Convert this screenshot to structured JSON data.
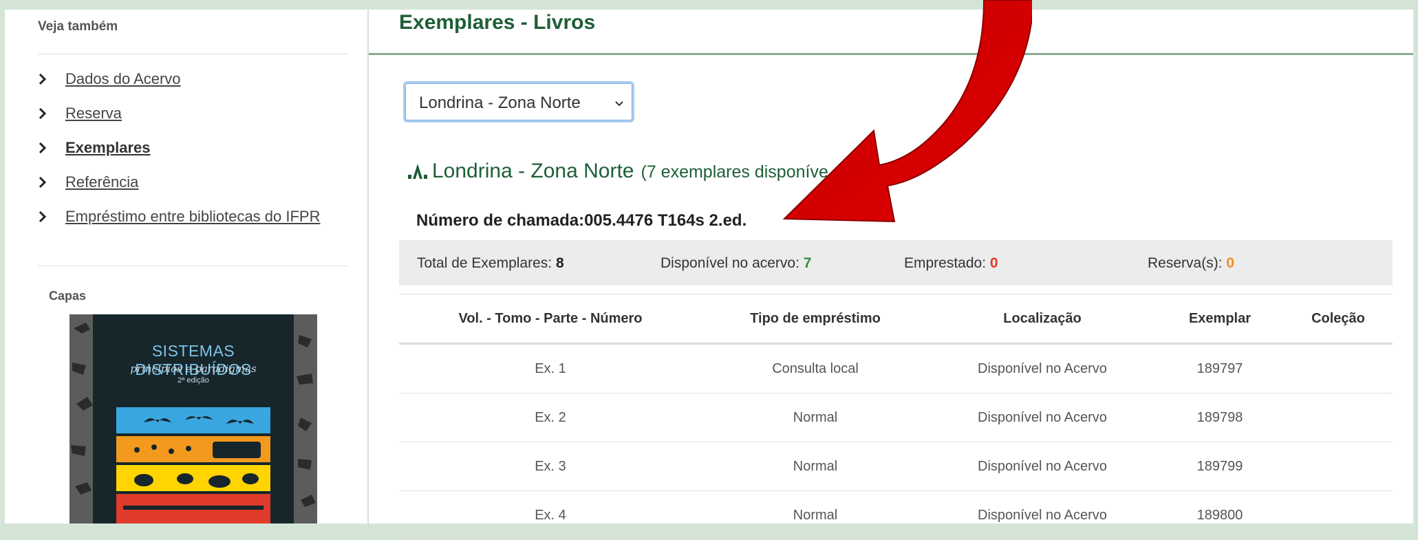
{
  "sidebar": {
    "heading": "Veja também",
    "items": [
      {
        "label": "Dados do Acervo",
        "active": false
      },
      {
        "label": "Reserva",
        "active": false
      },
      {
        "label": "Exemplares",
        "active": true
      },
      {
        "label": "Referência",
        "active": false
      },
      {
        "label": "Empréstimo entre bibliotecas do IFPR",
        "active": false
      }
    ],
    "capas_heading": "Capas",
    "cover": {
      "title": "SISTEMAS DISTRIBUÍDOS",
      "subtitle": "princípios e paradigmas",
      "edition": "2ª edição"
    }
  },
  "main": {
    "title": "Exemplares - Livros",
    "select": {
      "value": "Londrina - Zona Norte"
    },
    "library": {
      "name": "Londrina - Zona Norte",
      "count_text": "(7 exemplares disponíve"
    },
    "call_number": "Número de chamada:005.4476 T164s 2.ed.",
    "summary": {
      "total_label": "Total de Exemplares:",
      "total_value": "8",
      "available_label": "Disponível no acervo:",
      "available_value": "7",
      "loaned_label": "Emprestado:",
      "loaned_value": "0",
      "reserve_label": "Reserva(s):",
      "reserve_value": "0"
    },
    "table": {
      "headers": [
        "Vol. - Tomo - Parte - Número",
        "Tipo de empréstimo",
        "Localização",
        "Exemplar",
        "Coleção"
      ],
      "rows": [
        [
          "Ex. 1",
          "Consulta local",
          "Disponível no Acervo",
          "189797",
          ""
        ],
        [
          "Ex. 2",
          "Normal",
          "Disponível no Acervo",
          "189798",
          ""
        ],
        [
          "Ex. 3",
          "Normal",
          "Disponível no Acervo",
          "189799",
          ""
        ],
        [
          "Ex. 4",
          "Normal",
          "Disponível no Acervo",
          "189800",
          ""
        ]
      ]
    }
  },
  "colors": {
    "brand_green": "#1e5e37",
    "arrow_red": "#d30000",
    "available_green": "#3c8c3e",
    "loaned_red": "#e23a2e",
    "reserve_orange": "#f28c28"
  },
  "icons": [
    "chevron-right-icon",
    "library-icon",
    "chevron-down-icon",
    "red-curved-arrow"
  ]
}
